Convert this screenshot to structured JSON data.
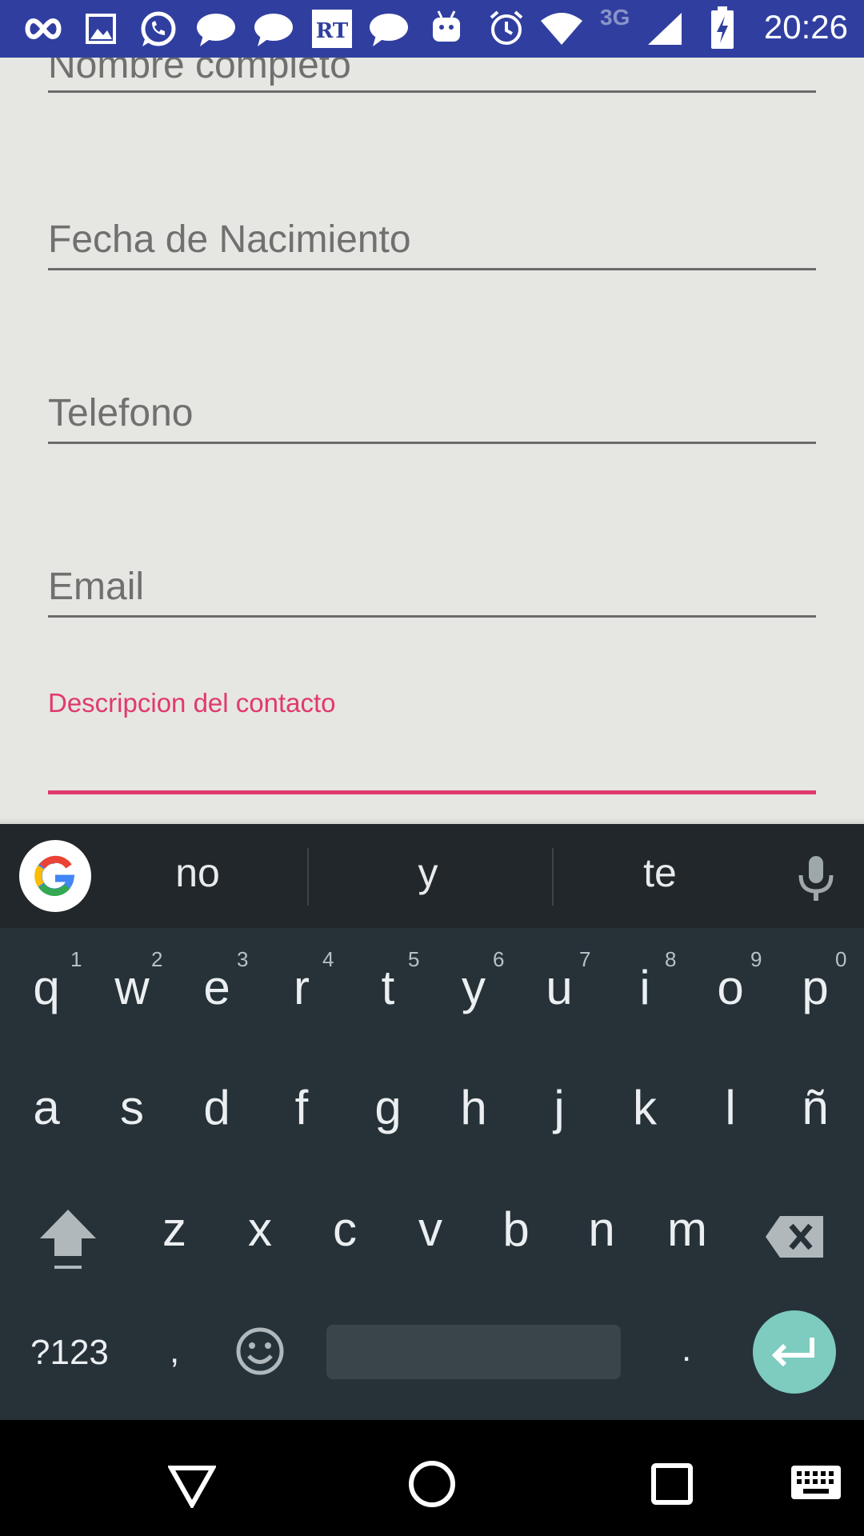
{
  "status_bar": {
    "time": "20:26",
    "network": "3G",
    "notification_icons": [
      "infinity-icon",
      "gallery-icon",
      "whatsapp-icon",
      "chat-bubble-icon",
      "chat-bubble-icon",
      "rt-news-icon",
      "chat-bubble-icon",
      "android-icon"
    ],
    "system_icons": [
      "alarm-icon",
      "wifi-icon",
      "signal-icon",
      "battery-charging-icon"
    ]
  },
  "form": {
    "fields": [
      {
        "label": "Nombre completo"
      },
      {
        "label": "Fecha de Nacimiento"
      },
      {
        "label": "Telefono"
      },
      {
        "label": "Email"
      },
      {
        "label": "Descripcion del contacto",
        "state": "focused"
      }
    ],
    "accent_color": "#e03a6c"
  },
  "keyboard": {
    "suggestions": [
      "no",
      "y",
      "te"
    ],
    "row1": [
      "q",
      "w",
      "e",
      "r",
      "t",
      "y",
      "u",
      "i",
      "o",
      "p"
    ],
    "row1_hints": [
      "1",
      "2",
      "3",
      "4",
      "5",
      "6",
      "7",
      "8",
      "9",
      "0"
    ],
    "row2": [
      "a",
      "s",
      "d",
      "f",
      "g",
      "h",
      "j",
      "k",
      "l",
      "ñ"
    ],
    "row3": [
      "z",
      "x",
      "c",
      "v",
      "b",
      "n",
      "m"
    ],
    "symbols_label": "?123",
    "comma": ",",
    "period": ".",
    "enter_color": "#7ecbc0"
  },
  "nav_bar": {
    "buttons": [
      "back-icon",
      "home-icon",
      "recents-icon",
      "keyboard-switch-icon"
    ]
  }
}
